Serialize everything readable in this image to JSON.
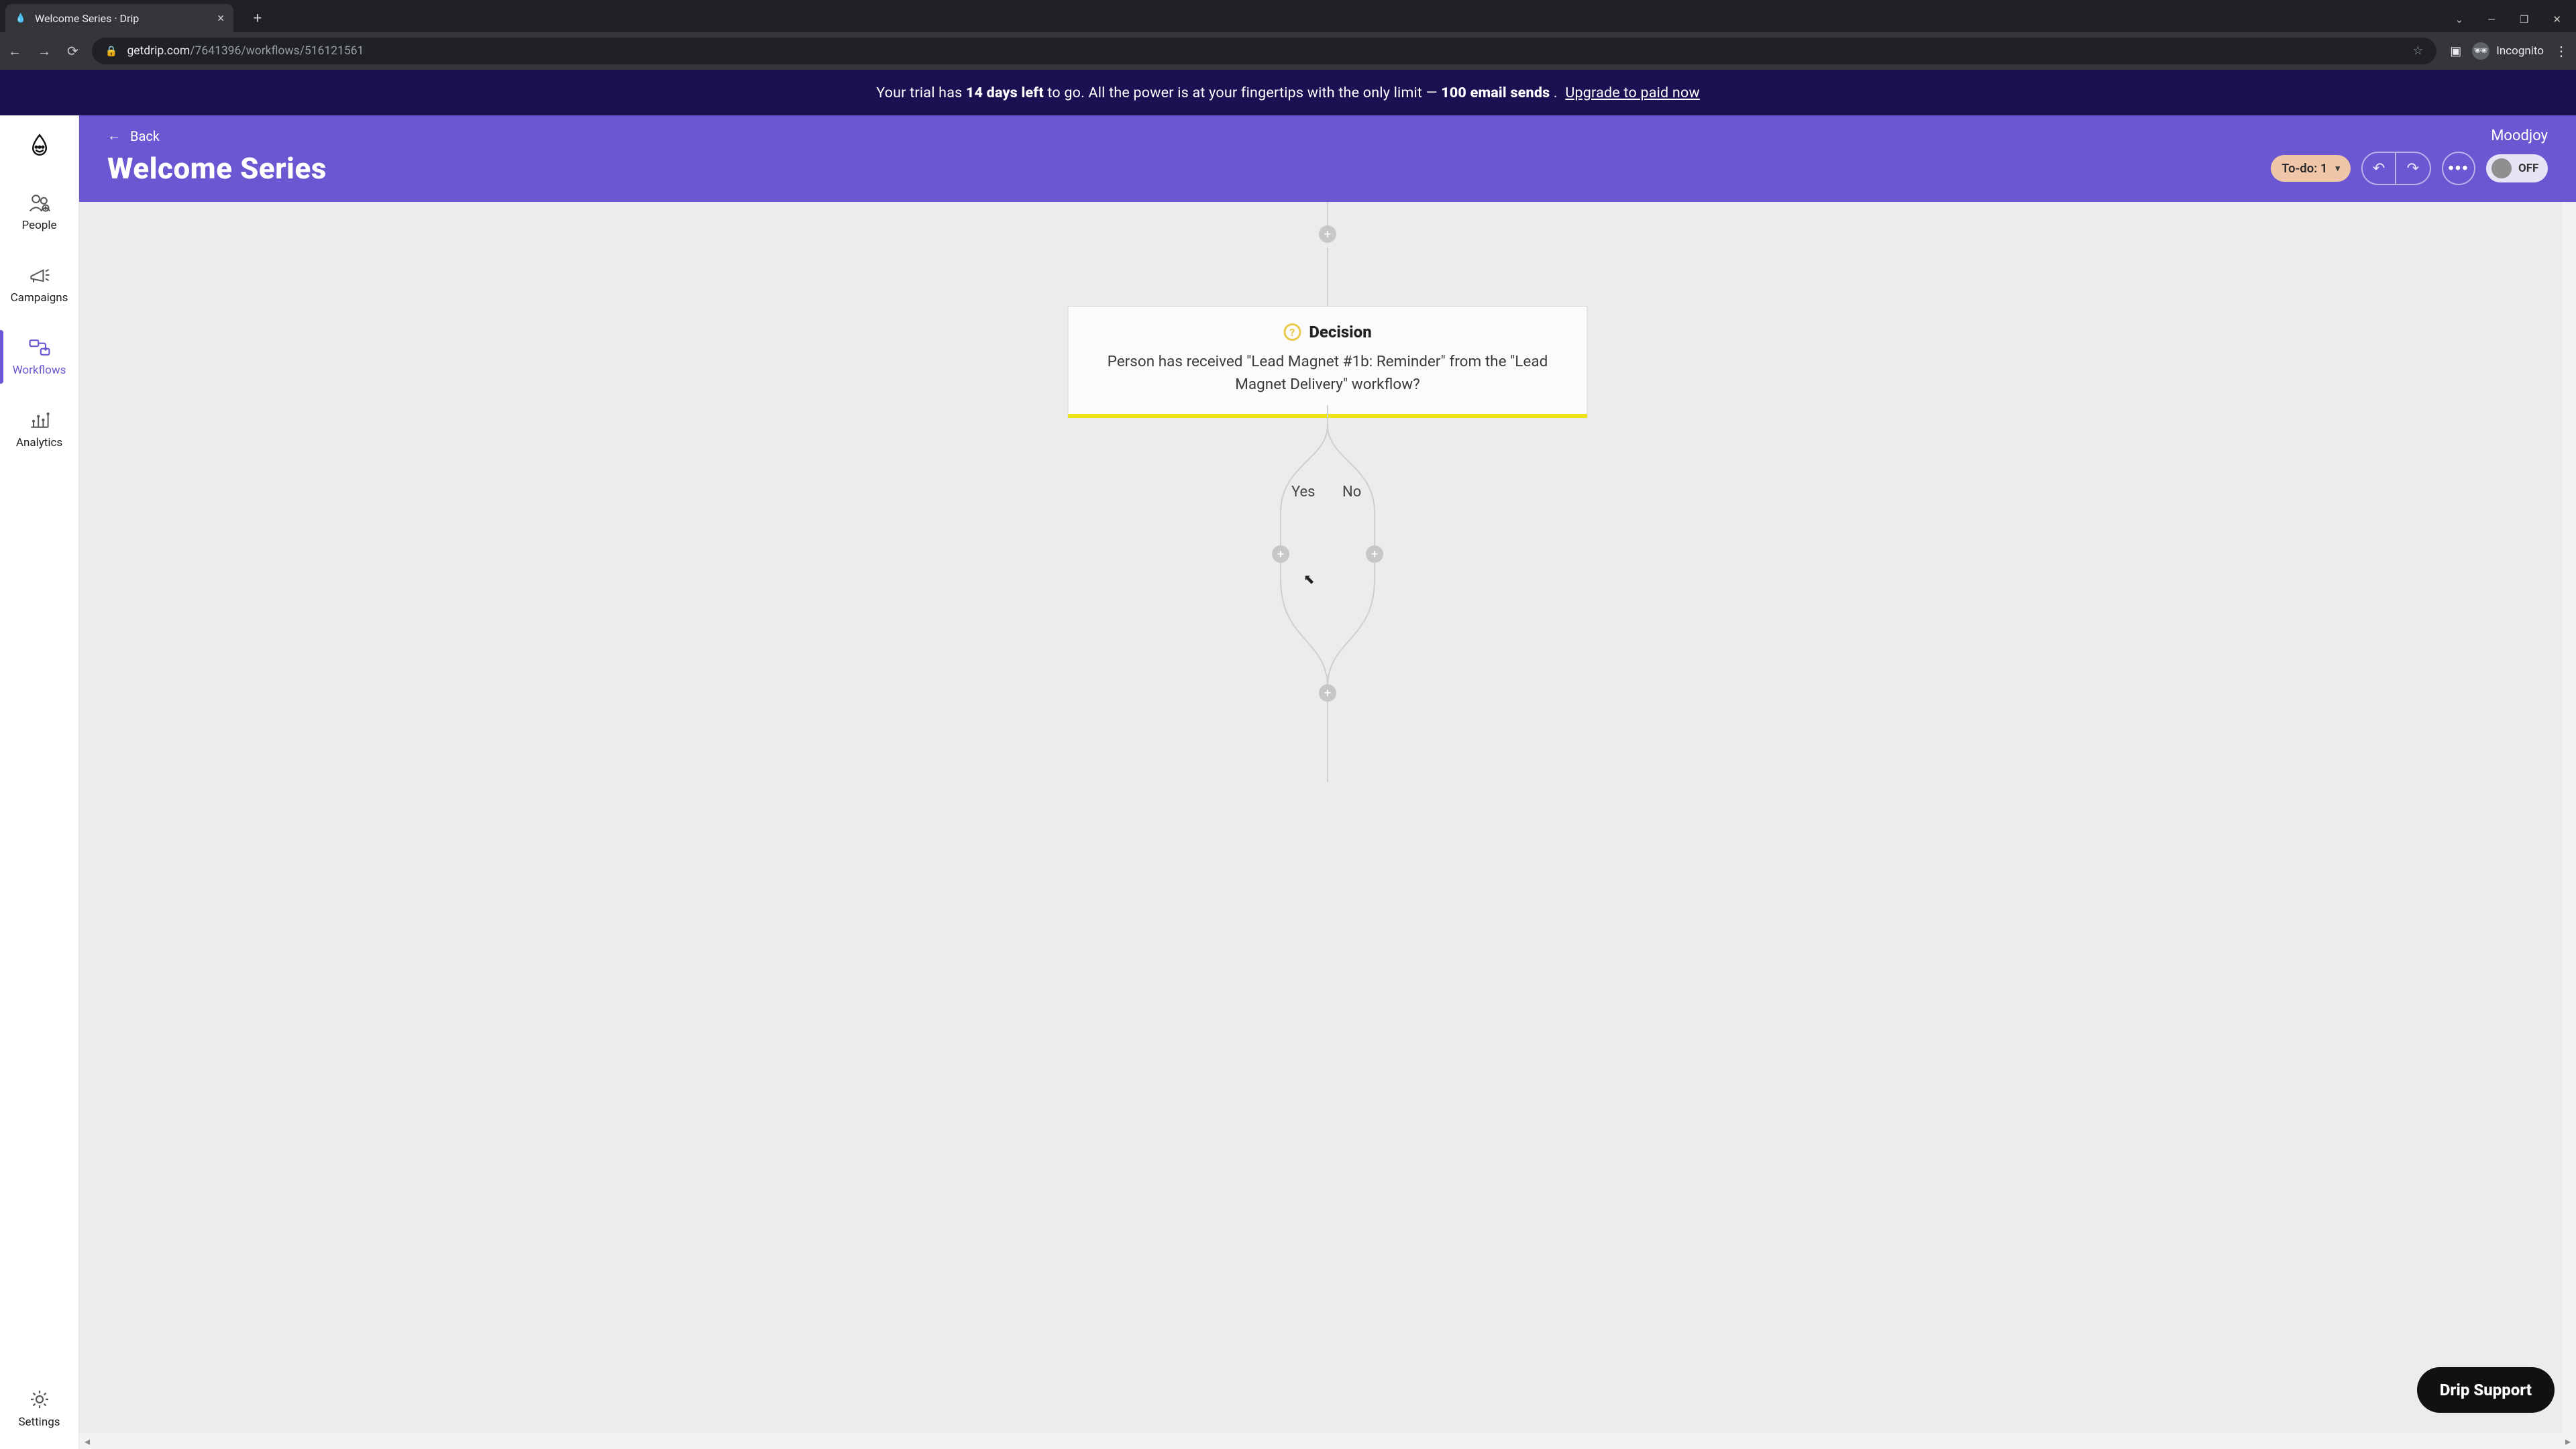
{
  "browser": {
    "tab_title": "Welcome Series · Drip",
    "url_host": "getdrip.com",
    "url_path": "/7641396/workflows/516121561",
    "incognito_label": "Incognito"
  },
  "banner": {
    "prefix": "Your trial has ",
    "bold1": "14 days left",
    "mid": " to go. All the power is at your fingertips with the only limit — ",
    "bold2": "100 email sends",
    "suffix": ". ",
    "cta": "Upgrade to paid now"
  },
  "sidebar": {
    "items": [
      {
        "label": "People"
      },
      {
        "label": "Campaigns"
      },
      {
        "label": "Workflows"
      },
      {
        "label": "Analytics"
      },
      {
        "label": "Settings"
      }
    ]
  },
  "header": {
    "back_label": "Back",
    "title": "Welcome Series",
    "org": "Moodjoy",
    "todo_label": "To-do: 1",
    "toggle_label": "OFF"
  },
  "canvas": {
    "decision_title": "Decision",
    "decision_text": "Person has received \"Lead Magnet #1b: Reminder\" from the \"Lead Magnet Delivery\" workflow?",
    "branch_yes": "Yes",
    "branch_no": "No"
  },
  "support_label": "Drip Support"
}
